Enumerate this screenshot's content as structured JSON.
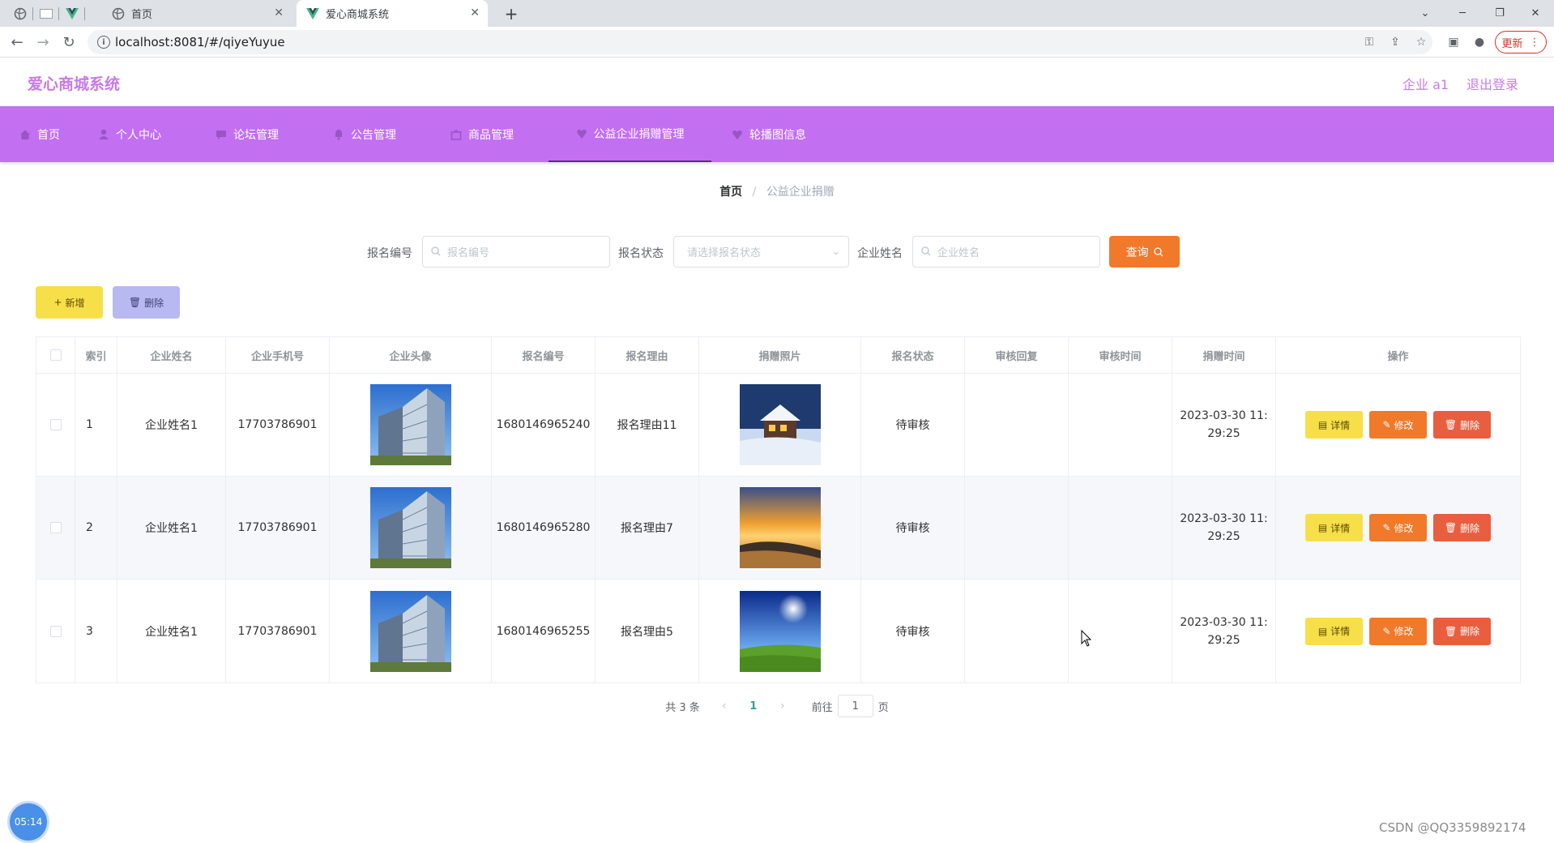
{
  "browser": {
    "tabs": [
      {
        "label": "首页"
      },
      {
        "label": "爱心商城系统"
      }
    ],
    "url": "localhost:8081/#/qiyeYuyue",
    "update_label": "更新"
  },
  "app": {
    "title": "爱心商城系统",
    "user_label": "企业 a1",
    "logout_label": "退出登录"
  },
  "nav": {
    "items": [
      {
        "label": "首页"
      },
      {
        "label": "个人中心"
      },
      {
        "label": "论坛管理"
      },
      {
        "label": "公告管理"
      },
      {
        "label": "商品管理"
      },
      {
        "label": "公益企业捐赠管理"
      },
      {
        "label": "轮播图信息"
      }
    ],
    "active_index": 5
  },
  "breadcrumb": {
    "home": "首页",
    "sep": "/",
    "current": "公益企业捐赠"
  },
  "filters": {
    "f1_label": "报名编号",
    "f1_placeholder": "报名编号",
    "f2_label": "报名状态",
    "f2_placeholder": "请选择报名状态",
    "f3_label": "企业姓名",
    "f3_placeholder": "企业姓名",
    "query_label": "查询"
  },
  "actions": {
    "add_label": "新增",
    "delete_label": "删除"
  },
  "table": {
    "columns": [
      "索引",
      "企业姓名",
      "企业手机号",
      "企业头像",
      "报名编号",
      "报名理由",
      "捐赠照片",
      "报名状态",
      "审核回复",
      "审核时间",
      "捐赠时间",
      "操作"
    ],
    "rows": [
      {
        "index": "1",
        "name": "企业姓名1",
        "phone": "17703786901",
        "no": "1680146965240",
        "reason": "报名理由11",
        "photo": "snow-house",
        "status": "待审核",
        "reply": "",
        "audit_time": "",
        "donate_time_1": "2023-03-30 11:",
        "donate_time_2": "29:25"
      },
      {
        "index": "2",
        "name": "企业姓名1",
        "phone": "17703786901",
        "no": "1680146965280",
        "reason": "报名理由7",
        "photo": "sunset-beach",
        "status": "待审核",
        "reply": "",
        "audit_time": "",
        "donate_time_1": "2023-03-30 11:",
        "donate_time_2": "29:25"
      },
      {
        "index": "3",
        "name": "企业姓名1",
        "phone": "17703786901",
        "no": "1680146965255",
        "reason": "报名理由5",
        "photo": "sunny-meadow",
        "status": "待审核",
        "reply": "",
        "audit_time": "",
        "donate_time_1": "2023-03-30 11:",
        "donate_time_2": "29:25"
      }
    ],
    "op_detail": "详情",
    "op_edit": "修改",
    "op_delete": "删除"
  },
  "pagination": {
    "total_label": "共 3 条",
    "current_page": "1",
    "goto_prefix": "前往",
    "goto_value": "1",
    "goto_suffix": "页"
  },
  "overlay": {
    "clock": "05:14",
    "watermark": "CSDN @QQ3359892174"
  },
  "colors": {
    "brand": "#c77ae6",
    "nav_bg": "#c26ff2",
    "query": "#f0792a",
    "add": "#f7df4a",
    "delete_batch": "#b8b9f0",
    "op_delete": "#e95e3f"
  }
}
